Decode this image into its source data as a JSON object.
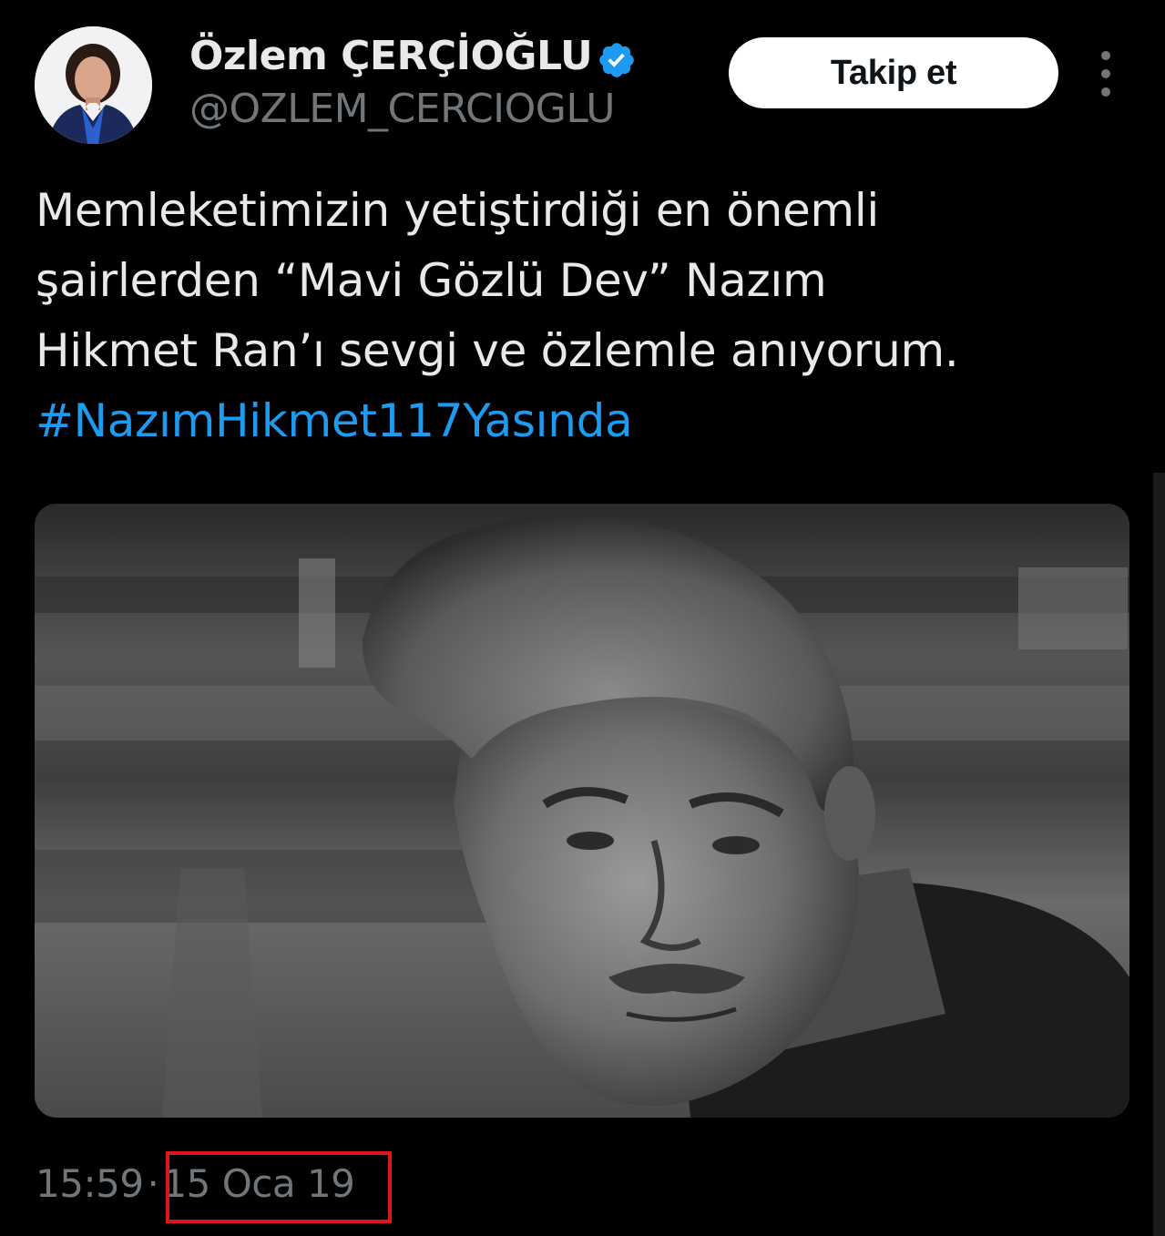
{
  "header": {
    "display_name": "Özlem ÇERÇİOĞLU",
    "handle": "@OZLEM_CERCIOGLU",
    "follow_label": "Takip et",
    "verified_icon": "verified-badge-icon",
    "more_icon": "more-options-icon"
  },
  "tweet": {
    "lines": [
      "Memleketimizin yetiştirdiği en önemli",
      "şairlerden “Mavi Gözlü Dev” Nazım",
      "Hikmet Ran’ı sevgi ve özlemle anıyorum."
    ],
    "hashtag": "#NazımHikmet117Yasında"
  },
  "meta": {
    "time": "15:59",
    "separator": "·",
    "date": "15 Oca 19"
  },
  "colors": {
    "background": "#000000",
    "text": "#e7e9ea",
    "muted": "#71767b",
    "link": "#1d9bf0",
    "highlight": "#e0141e",
    "verified": "#1d9bf0"
  }
}
